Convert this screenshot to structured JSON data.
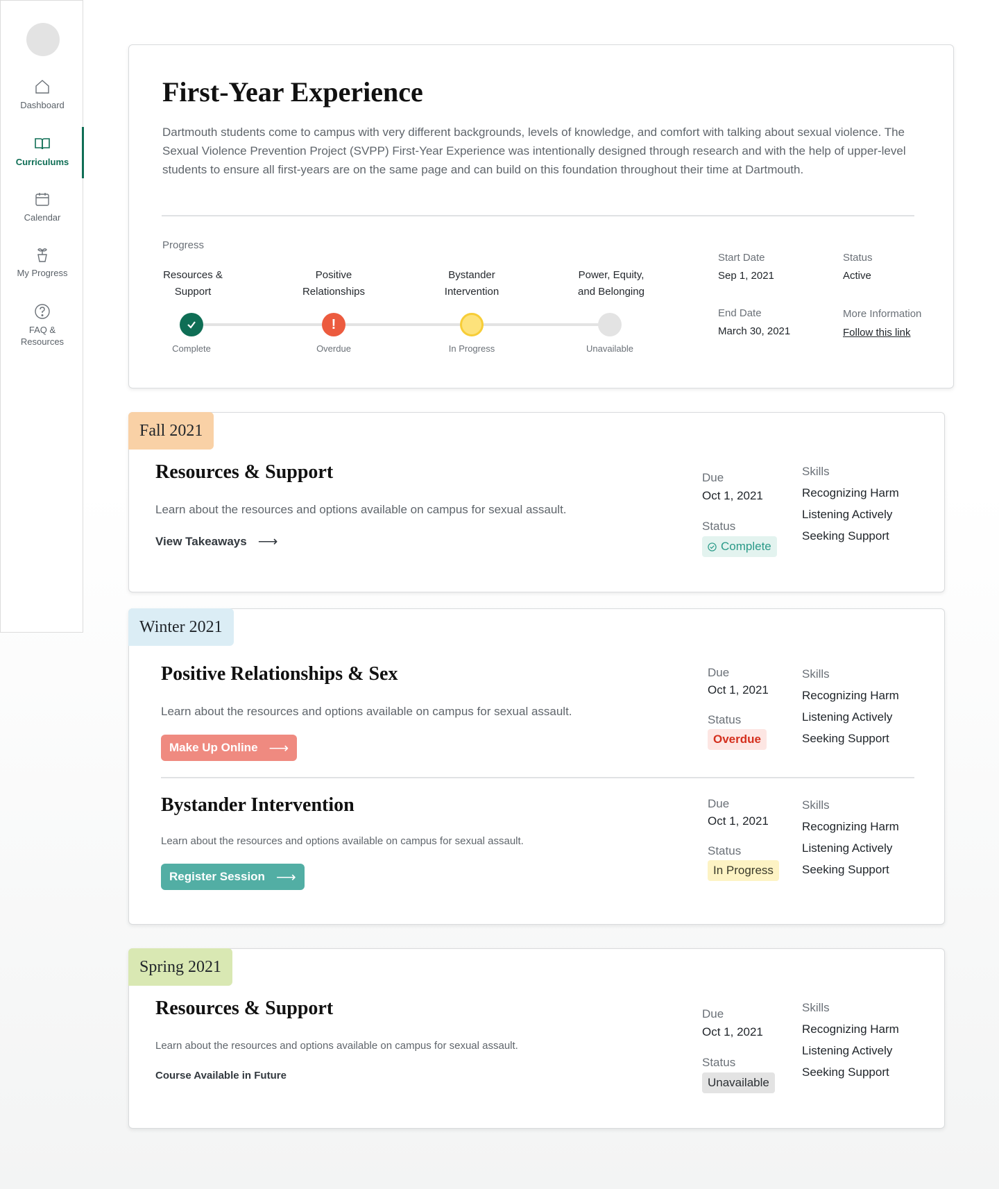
{
  "sidebar": {
    "items": [
      {
        "label": "Dashboard",
        "icon": "home-icon"
      },
      {
        "label": "Curriculums",
        "icon": "book-icon",
        "active": true
      },
      {
        "label": "Calendar",
        "icon": "calendar-icon"
      },
      {
        "label": "My Progress",
        "icon": "plant-pot-icon"
      },
      {
        "label_line1": "FAQ &",
        "label_line2": "Resources",
        "icon": "question-icon"
      }
    ]
  },
  "hero": {
    "title": "First-Year Experience",
    "description": "Dartmouth students come to campus with very different backgrounds, levels of knowledge, and comfort with talking about sexual violence. The Sexual Violence Prevention Project (SVPP) First-Year Experience was intentionally designed through research and with the help of upper-level students to ensure all first-years are on the same page and can build on this foundation throughout their time at Dartmouth.",
    "progress_label": "Progress",
    "steps": [
      {
        "line1": "Resources &",
        "line2": "Support",
        "status": "Complete"
      },
      {
        "line1": "Positive",
        "line2": "Relationships",
        "status": "Overdue"
      },
      {
        "line1": "Bystander",
        "line2": "Intervention",
        "status": "In Progress"
      },
      {
        "line1": "Power, Equity,",
        "line2": "and Belonging",
        "status": "Unavailable"
      }
    ],
    "start_date_label": "Start Date",
    "start_date": "Sep 1, 2021",
    "status_label": "Status",
    "status": "Active",
    "end_date_label": "End Date",
    "end_date": "March 30, 2021",
    "more_info_label": "More Information",
    "more_info_link": "Follow this link"
  },
  "labels": {
    "due": "Due",
    "status": "Status",
    "skills": "Skills"
  },
  "skills": [
    "Recognizing Harm",
    "Listening Actively",
    "Seeking Support"
  ],
  "terms": {
    "fall": {
      "name": "Fall 2021",
      "course": {
        "title": "Resources & Support",
        "description": "Learn about the resources and options available on campus for sexual assault.",
        "action": "View Takeaways",
        "due": "Oct 1, 2021",
        "status": "Complete"
      }
    },
    "winter": {
      "name": "Winter 2021",
      "courses": [
        {
          "title": "Positive Relationships & Sex",
          "description": "Learn about the resources and options available on campus for sexual assault.",
          "action": "Make Up Online",
          "due": "Oct 1, 2021",
          "status": "Overdue"
        },
        {
          "title": "Bystander Intervention",
          "description": "Learn about the resources and options available on campus for sexual assault.",
          "action": "Register Session",
          "due": "Oct 1, 2021",
          "status": "In Progress"
        }
      ]
    },
    "spring": {
      "name": "Spring 2021",
      "course": {
        "title": "Resources & Support",
        "description": "Learn about the resources and options available on campus for sexual assault.",
        "note": "Course Available in Future",
        "due": "Oct 1, 2021",
        "status": "Unavailable"
      }
    }
  },
  "colors": {
    "accent": "#0f6e55",
    "fall_tab": "#f9d1a6",
    "winter_tab": "#dbedf5",
    "spring_tab": "#d9e8b3",
    "overdue_button": "#ef8a80",
    "register_button": "#52aea4"
  }
}
